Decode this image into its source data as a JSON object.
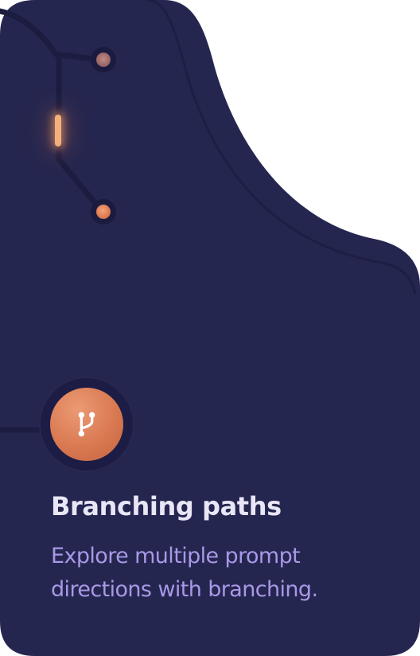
{
  "feature": {
    "title": "Branching paths",
    "description": "Explore multiple prompt directions with branching.",
    "icon": "git-branch-icon"
  },
  "colors": {
    "card_background": "#25264f",
    "title_text": "#e9e6f7",
    "description_text": "#a898e6",
    "accent": "#d97952"
  }
}
